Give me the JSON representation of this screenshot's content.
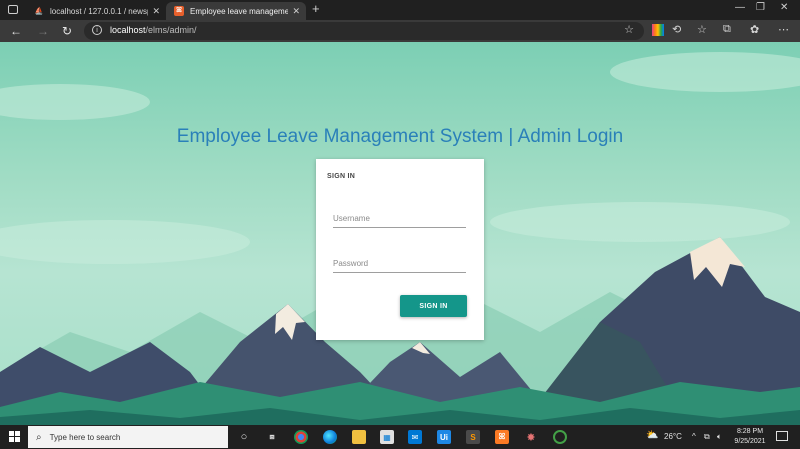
{
  "browser": {
    "tabs": [
      {
        "label": "localhost / 127.0.0.1 / newsporta",
        "favicon": "phpmyadmin-icon",
        "active": false
      },
      {
        "label": "Employee leave management sys",
        "favicon": "xampp-icon",
        "active": true
      }
    ],
    "url_host": "localhost",
    "url_path": "/elms/admin/"
  },
  "page": {
    "title": "Employee Leave Management System | Admin Login",
    "login": {
      "heading": "SIGN IN",
      "username_placeholder": "Username",
      "password_placeholder": "Password",
      "submit_label": "SIGN IN"
    },
    "colors": {
      "title": "#2a80b9",
      "button": "#14968a"
    }
  },
  "taskbar": {
    "search_placeholder": "Type here to search",
    "weather": "26°C",
    "time": "8:28 PM",
    "date": "9/25/2021"
  }
}
